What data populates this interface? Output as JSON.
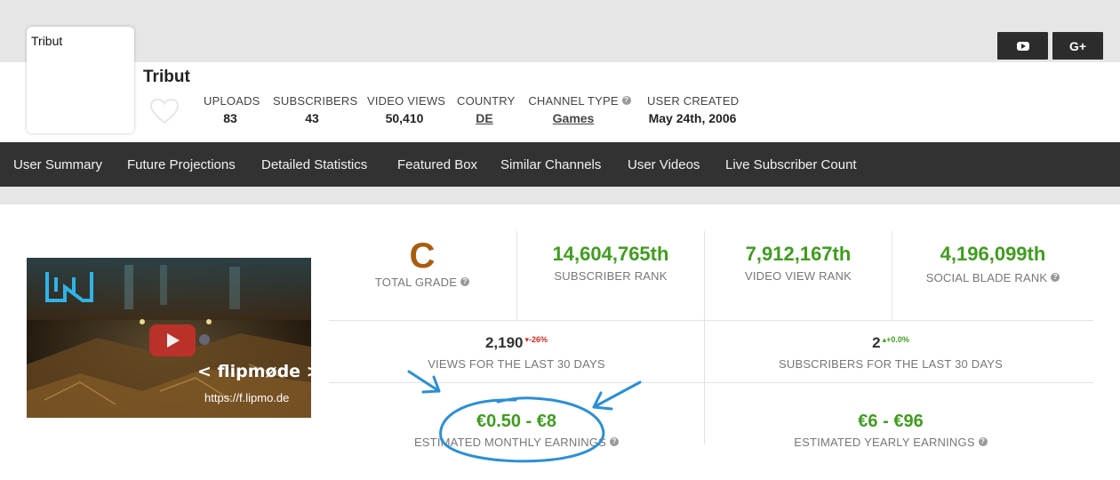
{
  "avatar": {
    "alt_text": "Tribut"
  },
  "channel": {
    "name": "Tribut"
  },
  "header_stats": [
    {
      "label": "UPLOADS",
      "value": "83"
    },
    {
      "label": "SUBSCRIBERS",
      "value": "43"
    },
    {
      "label": "VIDEO VIEWS",
      "value": "50,410"
    },
    {
      "label": "COUNTRY",
      "value": "DE"
    },
    {
      "label": "CHANNEL TYPE",
      "value": "Games"
    },
    {
      "label": "USER CREATED",
      "value": "May 24th, 2006"
    }
  ],
  "social": {
    "youtube_icon": "youtube-icon",
    "gplus_label": "G+"
  },
  "nav": [
    "User Summary",
    "Future Projections",
    "Detailed Statistics",
    "Featured Box",
    "Similar Channels",
    "User Videos",
    "Live Subscriber Count"
  ],
  "video": {
    "overlay_title": "< flipmøde >",
    "overlay_url": "https://f.lipmo.de"
  },
  "ranks": {
    "grade": {
      "value": "C",
      "label": "TOTAL GRADE"
    },
    "subscriber_rank": {
      "value": "14,604,765th",
      "label": "SUBSCRIBER RANK"
    },
    "video_view_rank": {
      "value": "7,912,167th",
      "label": "VIDEO VIEW RANK"
    },
    "social_blade_rank": {
      "value": "4,196,099th",
      "label": "SOCIAL BLADE RANK"
    }
  },
  "last30": {
    "views": {
      "value": "2,190",
      "delta": "-26%",
      "label": "VIEWS FOR THE LAST 30 DAYS"
    },
    "subscribers": {
      "value": "2",
      "delta": "+0.0%",
      "label": "SUBSCRIBERS FOR THE LAST 30 DAYS"
    }
  },
  "earnings": {
    "monthly": {
      "value": "€0.50 - €8",
      "label": "ESTIMATED MONTHLY EARNINGS"
    },
    "yearly": {
      "value": "€6 - €96",
      "label": "ESTIMATED YEARLY EARNINGS"
    }
  },
  "colors": {
    "green": "#3f9d1e",
    "grade": "#a85d0e",
    "nav_bg": "#323232",
    "annotation": "#2a8fd6"
  }
}
